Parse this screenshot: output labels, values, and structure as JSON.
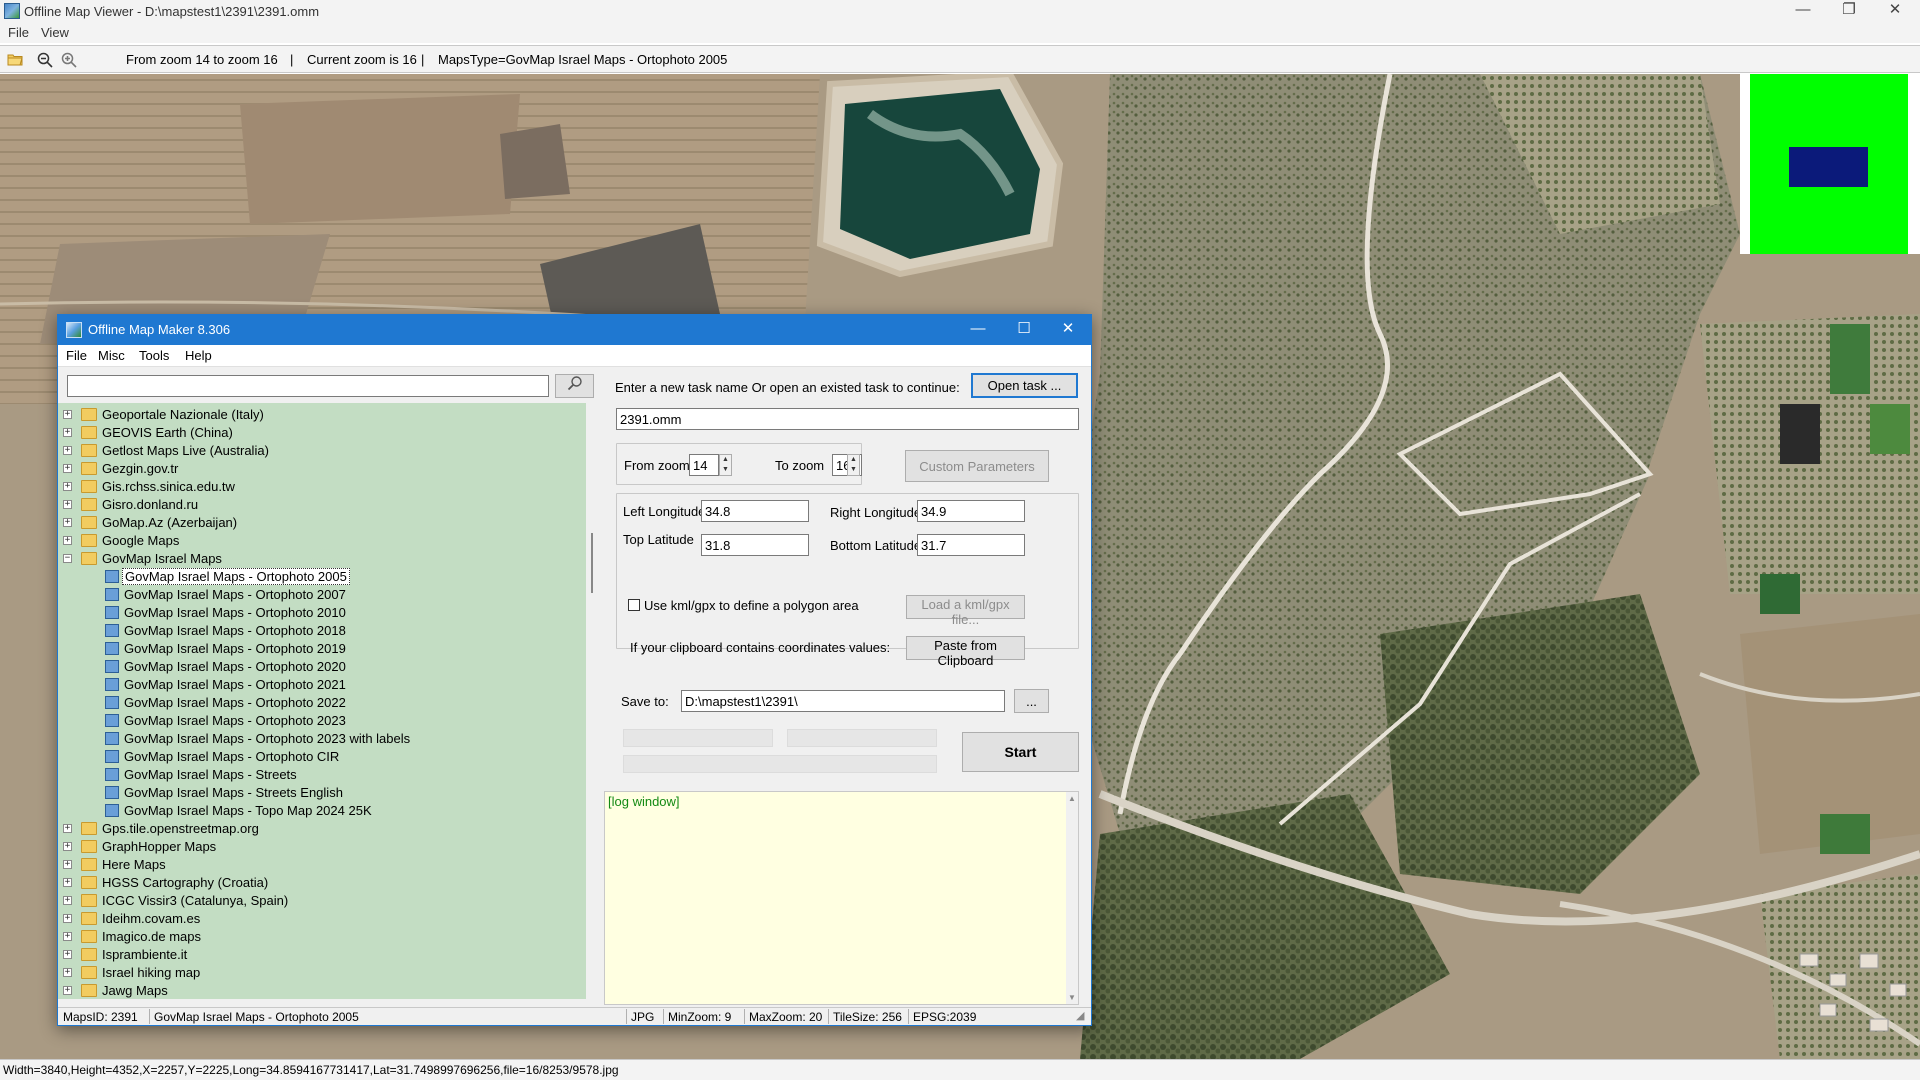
{
  "viewer": {
    "title": "Offline Map Viewer - D:\\mapstest1\\2391\\2391.omm",
    "menu": [
      "File",
      "View"
    ],
    "toolbar": {
      "zoom_range": "From zoom 14 to zoom 16",
      "sep1": "|",
      "current_zoom": "Current zoom is 16",
      "sep2": "|",
      "maps_type": "MapsType=GovMap Israel Maps - Ortophoto 2005"
    },
    "status": "Width=3840,Height=4352,X=2257,Y=2225,Long=34.8594167731417,Lat=31.7498997696256,file=16/8253/9578.jpg",
    "window_buttons": {
      "minimize": "—",
      "maximize": "❐",
      "close": "✕"
    }
  },
  "overview_colors": {
    "background": "#00ff00",
    "viewport": "#0b1a7a"
  },
  "dialog": {
    "title": "Offline Map Maker 8.306",
    "window_buttons": {
      "minimize": "—",
      "maximize": "☐",
      "close": "✕"
    },
    "menu": [
      "File",
      "Misc",
      "Tools",
      "Help"
    ],
    "search": {
      "value": "",
      "icon": "search-icon"
    },
    "tree": [
      {
        "label": "Geoportale Nazionale (Italy)",
        "level": 0,
        "expanded": false
      },
      {
        "label": "GEOVIS Earth (China)",
        "level": 0,
        "expanded": false
      },
      {
        "label": "Getlost Maps Live (Australia)",
        "level": 0,
        "expanded": false
      },
      {
        "label": "Gezgin.gov.tr",
        "level": 0,
        "expanded": false
      },
      {
        "label": "Gis.rchss.sinica.edu.tw",
        "level": 0,
        "expanded": false
      },
      {
        "label": "Gisro.donland.ru",
        "level": 0,
        "expanded": false
      },
      {
        "label": "GoMap.Az (Azerbaijan)",
        "level": 0,
        "expanded": false
      },
      {
        "label": "Google Maps",
        "level": 0,
        "expanded": false
      },
      {
        "label": "GovMap Israel Maps",
        "level": 0,
        "expanded": true
      },
      {
        "label": "GovMap Israel Maps - Ortophoto 2005",
        "level": 1,
        "selected": true
      },
      {
        "label": "GovMap Israel Maps - Ortophoto 2007",
        "level": 1
      },
      {
        "label": "GovMap Israel Maps - Ortophoto 2010",
        "level": 1
      },
      {
        "label": "GovMap Israel Maps - Ortophoto 2018",
        "level": 1
      },
      {
        "label": "GovMap Israel Maps - Ortophoto 2019",
        "level": 1
      },
      {
        "label": "GovMap Israel Maps - Ortophoto 2020",
        "level": 1
      },
      {
        "label": "GovMap Israel Maps - Ortophoto 2021",
        "level": 1
      },
      {
        "label": "GovMap Israel Maps - Ortophoto 2022",
        "level": 1
      },
      {
        "label": "GovMap Israel Maps - Ortophoto 2023",
        "level": 1
      },
      {
        "label": "GovMap Israel Maps - Ortophoto 2023 with labels",
        "level": 1
      },
      {
        "label": "GovMap Israel Maps - Ortophoto CIR",
        "level": 1
      },
      {
        "label": "GovMap Israel Maps - Streets",
        "level": 1
      },
      {
        "label": "GovMap Israel Maps - Streets English",
        "level": 1
      },
      {
        "label": "GovMap Israel Maps - Topo Map 2024 25K",
        "level": 1
      },
      {
        "label": "Gps.tile.openstreetmap.org",
        "level": 0,
        "expanded": false
      },
      {
        "label": "GraphHopper Maps",
        "level": 0,
        "expanded": false
      },
      {
        "label": "Here Maps",
        "level": 0,
        "expanded": false
      },
      {
        "label": "HGSS Cartography (Croatia)",
        "level": 0,
        "expanded": false
      },
      {
        "label": "ICGC Vissir3 (Catalunya, Spain)",
        "level": 0,
        "expanded": false
      },
      {
        "label": "Ideihm.covam.es",
        "level": 0,
        "expanded": false
      },
      {
        "label": "Imagico.de maps",
        "level": 0,
        "expanded": false
      },
      {
        "label": "Isprambiente.it",
        "level": 0,
        "expanded": false
      },
      {
        "label": "Israel hiking map",
        "level": 0,
        "expanded": false
      },
      {
        "label": "Jawg Maps",
        "level": 0,
        "expanded": false
      }
    ],
    "task": {
      "prompt": "Enter a new task name Or open an existed task to continue:",
      "open_button": "Open task ...",
      "name": "2391.omm"
    },
    "zoom": {
      "from_label": "From zoom",
      "from_value": "14",
      "to_label": "To zoom",
      "to_value": "16",
      "custom_button": "Custom Parameters"
    },
    "coords": {
      "left_lon_label": "Left Longitude",
      "left_lon": "34.8",
      "right_lon_label": "Right Longitude",
      "right_lon": "34.9",
      "top_lat_label": "Top Latitude",
      "top_lat": "31.8",
      "bottom_lat_label": "Bottom Latitude",
      "bottom_lat": "31.7",
      "kml_label": "Use kml/gpx to define a polygon area",
      "kml_button": "Load a kml/gpx file...",
      "clipboard_label": "If your clipboard contains coordinates values:",
      "clipboard_button": "Paste from Clipboard"
    },
    "save": {
      "label": "Save to:",
      "path": "D:\\mapstest1\\2391\\",
      "browse": "..."
    },
    "start_button": "Start",
    "log": "[log window]",
    "status": {
      "maps_id": "MapsID: 2391",
      "maps_name": "GovMap Israel Maps - Ortophoto 2005",
      "format": "JPG",
      "min_zoom": "MinZoom: 9",
      "max_zoom": "MaxZoom: 20",
      "tile_size": "TileSize: 256",
      "epsg": "EPSG:2039"
    }
  }
}
